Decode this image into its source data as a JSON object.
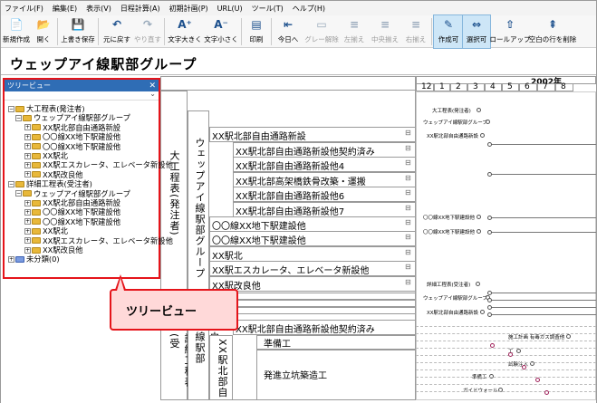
{
  "menu": [
    "ファイル(F)",
    "編集(E)",
    "表示(V)",
    "日程計算(A)",
    "初期計画(P)",
    "URL(U)",
    "ツール(T)",
    "ヘルプ(H)"
  ],
  "toolbar": [
    {
      "label": "新規作成",
      "icon": "new-file-icon"
    },
    {
      "label": "開く",
      "icon": "open-folder-icon"
    },
    {
      "label": "上書き保存",
      "icon": "save-icon"
    },
    {
      "label": "元に戻す",
      "icon": "undo-icon"
    },
    {
      "label": "やり直す",
      "icon": "redo-icon"
    },
    {
      "label": "文字大きく",
      "icon": "font-larger-icon"
    },
    {
      "label": "文字小さく",
      "icon": "font-smaller-icon"
    },
    {
      "label": "印刷",
      "icon": "print-icon"
    },
    {
      "label": "今日へ",
      "icon": "today-icon"
    },
    {
      "label": "グレー解除",
      "icon": "ungray-icon"
    },
    {
      "label": "左揃え",
      "icon": "align-left-icon"
    },
    {
      "label": "中央揃え",
      "icon": "align-center-icon"
    },
    {
      "label": "右揃え",
      "icon": "align-right-icon"
    },
    {
      "label": "作成可",
      "icon": "create-mode-icon"
    },
    {
      "label": "選択可",
      "icon": "select-mode-icon"
    },
    {
      "label": "ロールアップ",
      "icon": "rollup-icon"
    },
    {
      "label": "空白の行を削除",
      "icon": "delete-blank-rows-icon"
    }
  ],
  "title": "ウェップアイ線駅部グループ",
  "tree": {
    "header": "ツリービュー",
    "nodes": [
      {
        "label": "大工程表(発注者)",
        "level": 0
      },
      {
        "label": "ウェップアイ線駅部グループ",
        "level": 1
      },
      {
        "label": "XX駅北部自由通路新設",
        "level": 2
      },
      {
        "label": "〇〇線XX地下駅建設他",
        "level": 2
      },
      {
        "label": "〇〇線XX地下駅建設他",
        "level": 2
      },
      {
        "label": "XX駅北",
        "level": 2
      },
      {
        "label": "XX駅エスカレータ、エレベータ新設他",
        "level": 2
      },
      {
        "label": "XX駅改良他",
        "level": 2
      },
      {
        "label": "詳細工程表(受注者)",
        "level": 0
      },
      {
        "label": "ウェップアイ線駅部グループ",
        "level": 1
      },
      {
        "label": "XX駅北部自由通路新設",
        "level": 2
      },
      {
        "label": "〇〇線XX地下駅建設他",
        "level": 2
      },
      {
        "label": "〇〇線XX地下駅建設他",
        "level": 2
      },
      {
        "label": "XX駅北",
        "level": 2
      },
      {
        "label": "XX駅エスカレータ、エレベータ新設他",
        "level": 2
      },
      {
        "label": "XX駅改良他",
        "level": 2
      },
      {
        "label": "未分類(0)",
        "level": 0
      }
    ]
  },
  "callout": "ツリービュー",
  "grid": {
    "year": "2002年",
    "months": [
      "12",
      "1",
      "2",
      "3",
      "4",
      "5",
      "6",
      "7",
      "8"
    ],
    "cat1": "大工程表(発注者)",
    "cat1_group": "ウェップアイ線駅部グループ",
    "cat2": "詳細工程表(受",
    "cat2_group": "ウェップアイ線駅部",
    "cat2_sub": "XX駅北部自",
    "rows1": [
      "XX駅北部自由通路新設",
      "XX駅北部自由通路新設他契約済み",
      "XX駅北部自由通路新設他4",
      "XX駅北部高架橋鉄骨改築・運搬",
      "XX駅北部自由通路新設他6",
      "XX駅北部自由通路新設他7",
      "〇〇線XX地下駅建設他",
      "〇〇線XX地下駅建設他",
      "XX駅北",
      "XX駅エスカレータ、エレベータ新設他",
      "XX駅改良他"
    ],
    "rows2": [
      "XX駅北部自由通路新設他契約済み",
      "準備工",
      "発進立坑築造工"
    ],
    "timeline_labels": [
      "大工程表(発注者)",
      "ウェップアイ線駅部グループ",
      "XX駅北部自由通路新設",
      "〇〇線XX地下駅建設他",
      "〇〇線XX地下駅建設他",
      "詳細工程表(受注者)",
      "ウェップアイ線駅部グループ",
      "XX駅北部自由通路新設",
      "施工計画 有毒ガス調査他",
      "工",
      "試験注入",
      "準備工",
      "ガイドウォール"
    ]
  },
  "colors": {
    "accent": "#2f6db5",
    "callout_border": "#e5141a",
    "callout_fill": "#ffd9d9",
    "selected_tool": "#cde6f7"
  }
}
